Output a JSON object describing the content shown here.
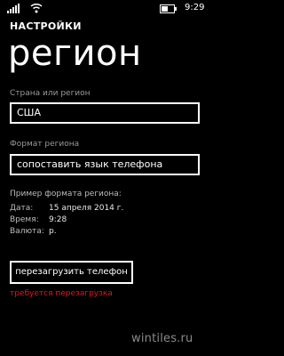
{
  "status_bar": {
    "signal_icon": "signal-bars-icon",
    "wifi_icon": "wifi-icon",
    "battery_icon": "battery-icon",
    "battery_level": 0.5,
    "time": "9:29"
  },
  "header": {
    "app_title": "НАСТРОЙКИ",
    "page_title": "регион"
  },
  "country": {
    "label": "Страна или регион",
    "value": "США"
  },
  "format": {
    "label": "Формат региона",
    "value": "сопоставить язык телефона"
  },
  "example": {
    "heading": "Пример формата региона:",
    "date_label": "Дата:",
    "date_value": "15  апреля 2014 г.",
    "time_label": "Время:",
    "time_value": "9:28",
    "currency_label": "Валюта:",
    "currency_value": "р."
  },
  "restart": {
    "button_label": "перезагрузить телефон",
    "warning": "требуется перезагрузка"
  },
  "watermark": "wintiles.ru",
  "colors": {
    "background": "#000000",
    "foreground": "#ffffff",
    "warning": "#e81123"
  }
}
